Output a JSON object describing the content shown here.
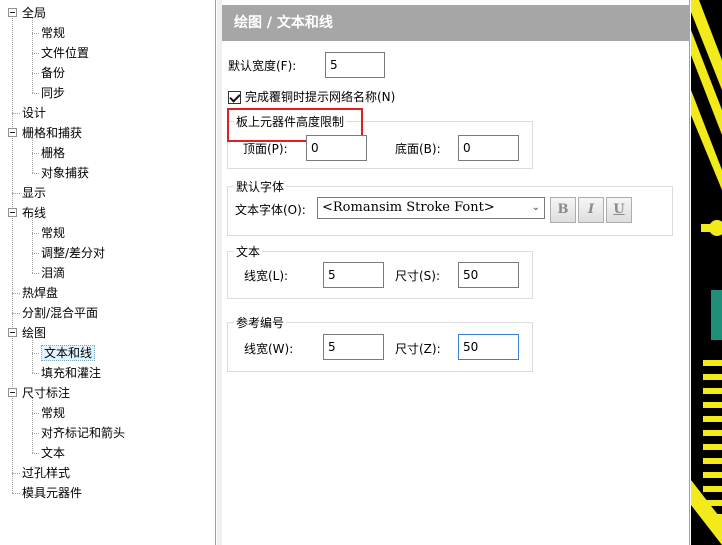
{
  "tree": {
    "items": [
      {
        "label": "全局",
        "level": 0,
        "expander": true
      },
      {
        "label": "常规",
        "level": 1
      },
      {
        "label": "文件位置",
        "level": 1
      },
      {
        "label": "备份",
        "level": 1
      },
      {
        "label": "同步",
        "level": 1
      },
      {
        "label": "设计",
        "level": 0
      },
      {
        "label": "栅格和捕获",
        "level": 0,
        "expander": true
      },
      {
        "label": "栅格",
        "level": 1
      },
      {
        "label": "对象捕获",
        "level": 1
      },
      {
        "label": "显示",
        "level": 0
      },
      {
        "label": "布线",
        "level": 0,
        "expander": true
      },
      {
        "label": "常规",
        "level": 1
      },
      {
        "label": "调整/差分对",
        "level": 1
      },
      {
        "label": "泪滴",
        "level": 1
      },
      {
        "label": "热焊盘",
        "level": 0
      },
      {
        "label": "分割/混合平面",
        "level": 0
      },
      {
        "label": "绘图",
        "level": 0,
        "expander": true
      },
      {
        "label": "文本和线",
        "level": 1,
        "selected": true
      },
      {
        "label": "填充和灌注",
        "level": 1
      },
      {
        "label": "尺寸标注",
        "level": 0,
        "expander": true
      },
      {
        "label": "常规",
        "level": 1
      },
      {
        "label": "对齐标记和箭头",
        "level": 1
      },
      {
        "label": "文本",
        "level": 1
      },
      {
        "label": "过孔样式",
        "level": 0
      },
      {
        "label": "模具元器件",
        "level": 0
      }
    ]
  },
  "panel": {
    "title": "绘图 / 文本和线",
    "default_width_label": "默认宽度(F):",
    "default_width_value": "5",
    "complete_copper_label": "完成覆铜时提示网络名称(N)",
    "height_group": {
      "title": "板上元器件高度限制",
      "top_label": "顶面(P):",
      "top_value": "0",
      "bottom_label": "底面(B):",
      "bottom_value": "0"
    },
    "font_group": {
      "title": "默认字体",
      "font_label": "文本字体(O):",
      "font_value": "<Romansim Stroke Font>",
      "bold": "B",
      "italic": "I",
      "underline": "U"
    },
    "text_group": {
      "title": "文本",
      "linewidth_label": "线宽(L):",
      "linewidth_value": "5",
      "size_label": "尺寸(S):",
      "size_value": "50"
    },
    "refdes_group": {
      "title": "参考编号",
      "linewidth_label": "线宽(W):",
      "linewidth_value": "5",
      "size_label": "尺寸(Z):",
      "size_value": "50"
    }
  },
  "colors": {
    "header_bg": "#a6a6a6",
    "highlight_box": "#e02020",
    "pcb_yellow": "#f2ea1b",
    "pcb_teal": "#1f8f7a"
  }
}
